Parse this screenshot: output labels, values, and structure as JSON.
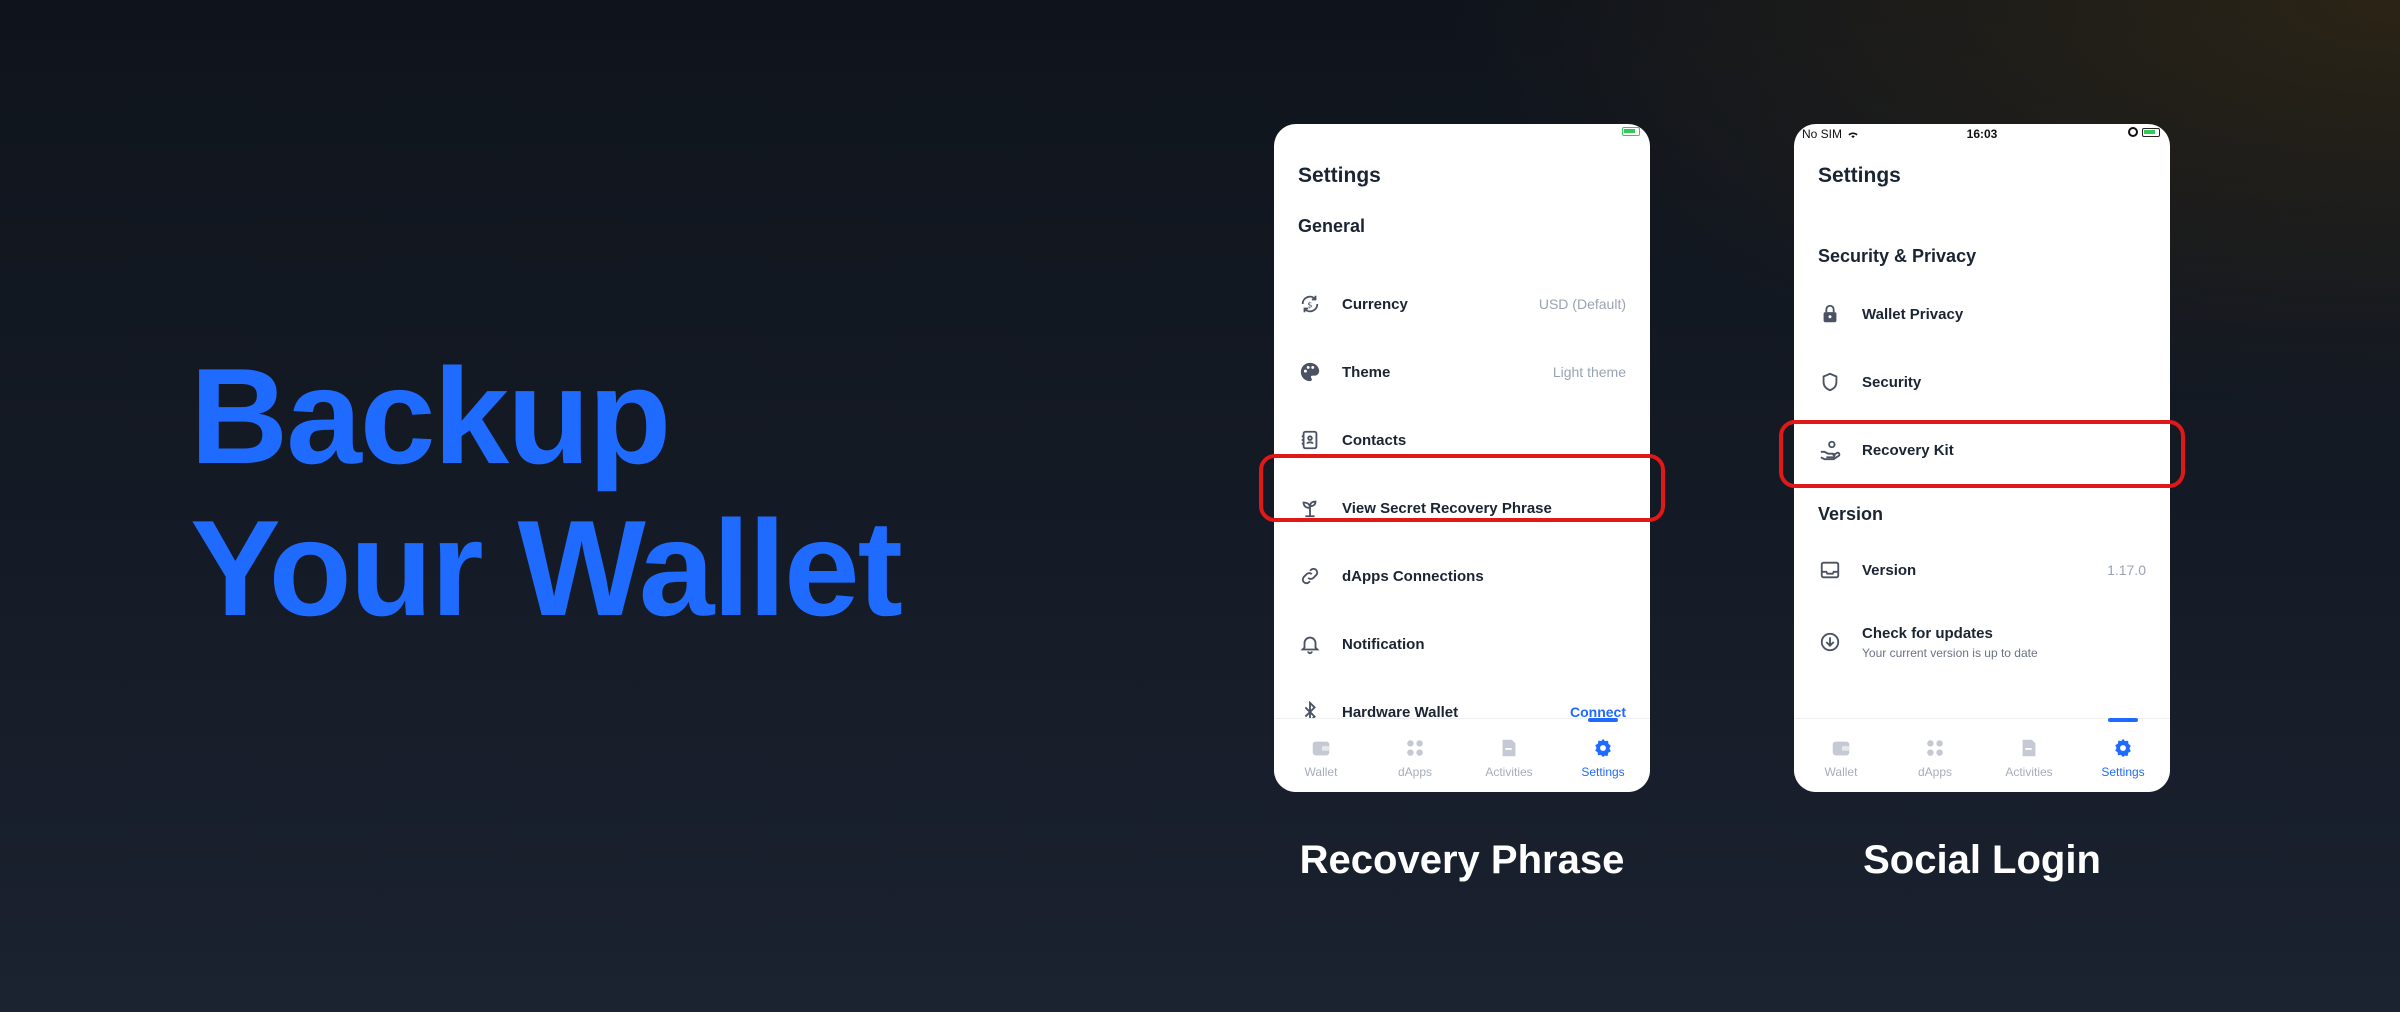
{
  "hero": {
    "line1": "Backup",
    "line2": "Your Wallet"
  },
  "captions": {
    "left": "Recovery Phrase",
    "right": "Social Login"
  },
  "colors": {
    "accent": "#1f6bff",
    "highlight": "#e01818"
  },
  "phone1": {
    "title": "Settings",
    "section": "General",
    "rows": [
      {
        "icon": "currency-exchange-icon",
        "label": "Currency",
        "value": "USD (Default)"
      },
      {
        "icon": "palette-icon",
        "label": "Theme",
        "value": "Light theme"
      },
      {
        "icon": "contacts-book-icon",
        "label": "Contacts",
        "value": ""
      },
      {
        "icon": "sprout-icon",
        "label": "View Secret Recovery Phrase",
        "value": ""
      },
      {
        "icon": "link-icon",
        "label": "dApps Connections",
        "value": ""
      },
      {
        "icon": "bell-icon",
        "label": "Notification",
        "value": ""
      },
      {
        "icon": "bluetooth-icon",
        "label": "Hardware Wallet",
        "value": "Connect"
      }
    ],
    "tabs": [
      "Wallet",
      "dApps",
      "Activities",
      "Settings"
    ],
    "active_tab": "Settings"
  },
  "phone2": {
    "status": {
      "carrier": "No SIM",
      "time": "16:03"
    },
    "title": "Settings",
    "section_security": "Security & Privacy",
    "security_rows": [
      {
        "icon": "lock-icon",
        "label": "Wallet Privacy"
      },
      {
        "icon": "shield-icon",
        "label": "Security"
      },
      {
        "icon": "hand-coin-icon",
        "label": "Recovery Kit"
      }
    ],
    "section_version": "Version",
    "version_row": {
      "icon": "inbox-tray-icon",
      "label": "Version",
      "value": "1.17.0"
    },
    "updates_row": {
      "icon": "download-circle-icon",
      "label": "Check for updates",
      "sub": "Your current version is up to date"
    },
    "tabs": [
      "Wallet",
      "dApps",
      "Activities",
      "Settings"
    ],
    "active_tab": "Settings"
  }
}
